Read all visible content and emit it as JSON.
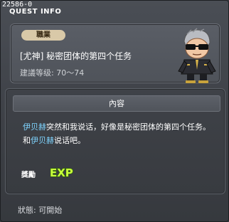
{
  "window": {
    "id_label": "22586-0",
    "title": "QUEST INFO"
  },
  "quest": {
    "job_badge": "職業",
    "name": "[尤神]  秘密团体的第四个任务",
    "level_range": "建議等级: 70～74"
  },
  "content": {
    "section_title": "內容",
    "desc_segments": [
      {
        "text": "伊贝赫",
        "npc": true
      },
      {
        "text": "突然和我说话，好像是秘密团体的第四个任务。和",
        "npc": false
      },
      {
        "text": "伊贝赫",
        "npc": true
      },
      {
        "text": "说话吧。",
        "npc": false
      }
    ],
    "reward_label": "獎勵",
    "reward_icon": "exp-icon",
    "reward_icon_text": "EXP"
  },
  "status": {
    "text": "狀態:  可開始"
  },
  "colors": {
    "npc_highlight": "#7fd4ff",
    "exp_fill": "#c8ff3c",
    "exp_outline": "#2f6a00",
    "badge_bg": "#d9c9a8"
  }
}
